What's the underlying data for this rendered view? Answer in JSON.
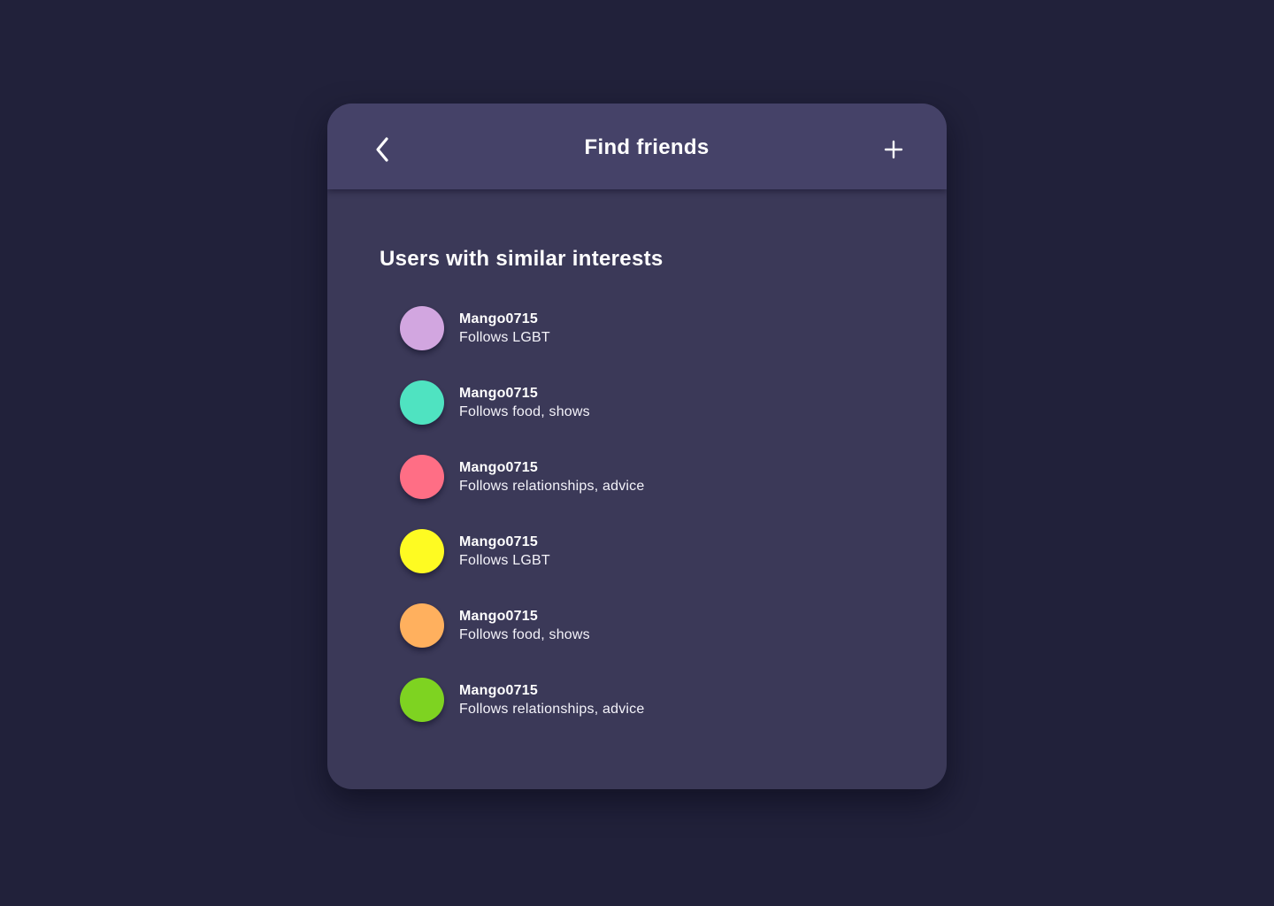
{
  "header": {
    "title": "Find friends",
    "back_icon": "chevron-left-icon",
    "add_icon": "plus-icon"
  },
  "section": {
    "title": "Users with similar interests"
  },
  "users": [
    {
      "name": "Mango0715",
      "interests": "Follows LGBT",
      "avatar_color": "#d2a6e0"
    },
    {
      "name": "Mango0715",
      "interests": "Follows food, shows",
      "avatar_color": "#4fe3c1"
    },
    {
      "name": "Mango0715",
      "interests": "Follows relationships, advice",
      "avatar_color": "#ff6e85"
    },
    {
      "name": "Mango0715",
      "interests": "Follows LGBT",
      "avatar_color": "#fefb22"
    },
    {
      "name": "Mango0715",
      "interests": "Follows food, shows",
      "avatar_color": "#ffb05e"
    },
    {
      "name": "Mango0715",
      "interests": "Follows relationships, advice",
      "avatar_color": "#7ed321"
    }
  ],
  "colors": {
    "background": "#21213a",
    "card": "#3b3958",
    "header": "#454268",
    "text": "#ffffff"
  }
}
